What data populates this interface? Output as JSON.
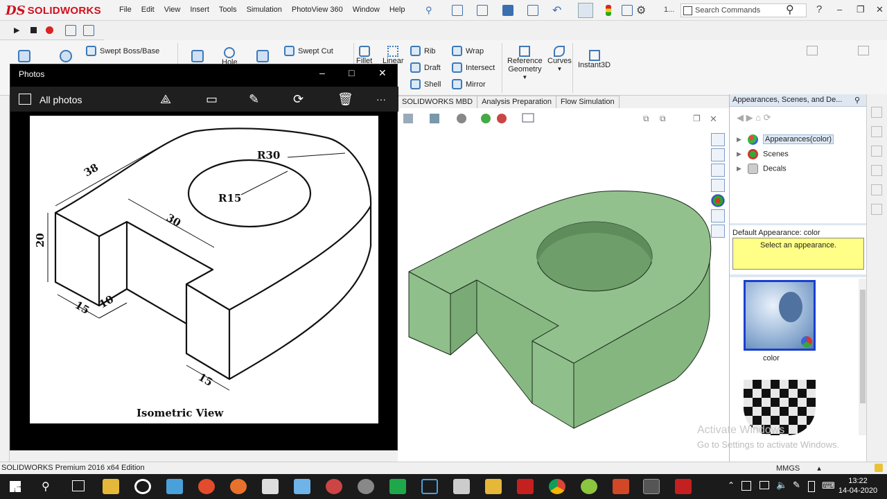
{
  "app": {
    "brand": "SOLIDWORKS",
    "ds": "DS",
    "menus": [
      "File",
      "Edit",
      "View",
      "Insert",
      "Tools",
      "Simulation",
      "PhotoView 360",
      "Window",
      "Help"
    ],
    "search_placeholder": "Search Commands",
    "status_text": "SOLIDWORKS Premium 2016 x64 Edition",
    "units": "MMGS",
    "units_arrow": "▴"
  },
  "commands": {
    "swept_boss": "Swept Boss/Base",
    "swept_cut": "Swept Cut",
    "hole": "Hole",
    "fillet": "Fillet",
    "linear": "Linear",
    "rib": "Rib",
    "draft": "Draft",
    "shell": "Shell",
    "wrap": "Wrap",
    "intersect": "Intersect",
    "mirror": "Mirror",
    "ref_geometry_1": "Reference",
    "ref_geometry_2": "Geometry",
    "curves": "Curves",
    "instant3d": "Instant3D"
  },
  "tabs": [
    "SOLIDWORKS MBD",
    "Analysis Preparation",
    "Flow Simulation"
  ],
  "taskpane": {
    "title": "Appearances, Scenes, and De...",
    "tree": [
      "Appearances(color)",
      "Scenes",
      "Decals"
    ],
    "default_label": "Default Appearance: color",
    "hint": "Select an appearance.",
    "swatch_label": "color"
  },
  "photos": {
    "title": "Photos",
    "breadcrumb": "All photos",
    "minimize": "–",
    "maximize": "□",
    "close": "✕",
    "more": "···"
  },
  "drawing": {
    "caption": "Isometric View",
    "dims": [
      "38",
      "20",
      "30",
      "R30",
      "R15",
      "15",
      "10",
      "15"
    ]
  },
  "watermark": {
    "line1": "Activate Windows",
    "line2": "Go to Settings to activate Windows."
  },
  "clock": {
    "time": "13:22",
    "date": "14-04-2020"
  },
  "colors": {
    "model_green": "#8fbf8a",
    "taskbar": "#1b1b1b",
    "sw_red": "#d0101c"
  }
}
